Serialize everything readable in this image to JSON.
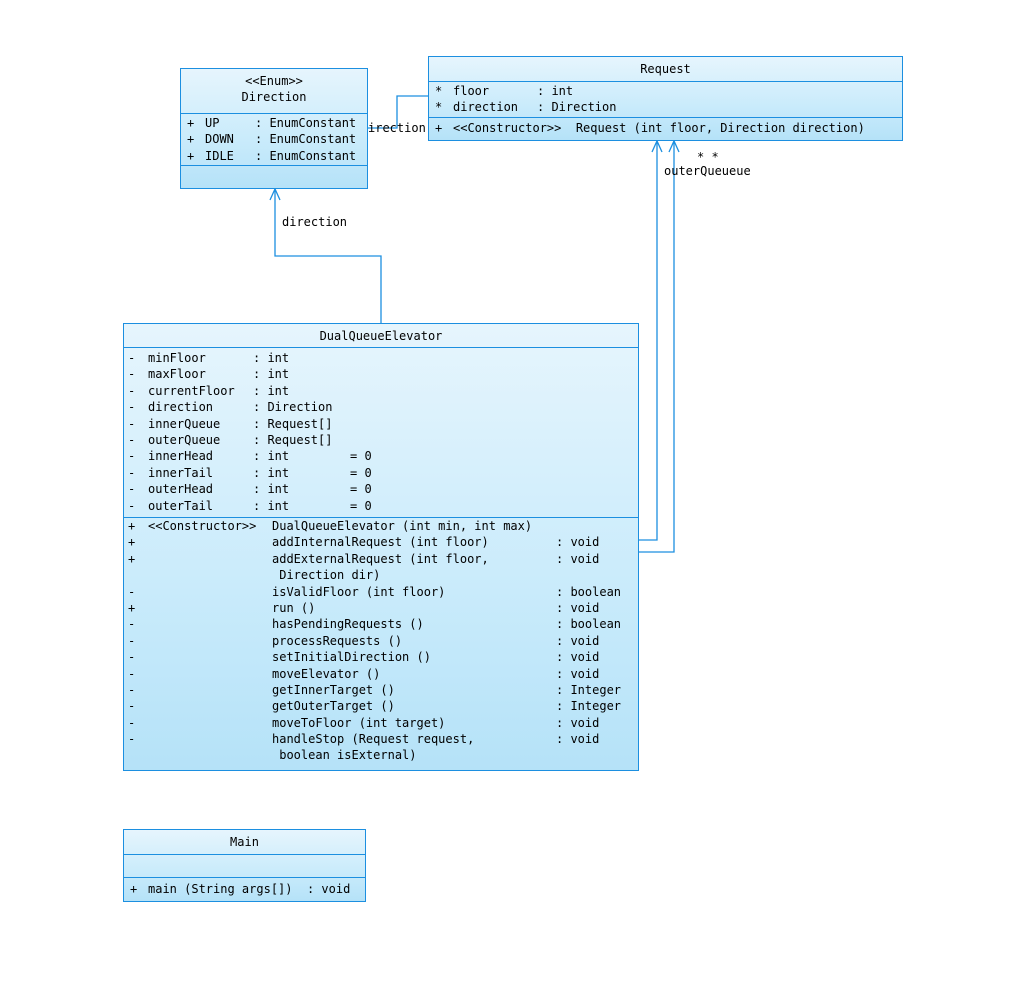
{
  "direction_class": {
    "stereotype": "<<Enum>>",
    "name": "Direction",
    "attributes": [
      {
        "vis": "+",
        "name": "UP",
        "type": ": EnumConstant"
      },
      {
        "vis": "+",
        "name": "DOWN",
        "type": ": EnumConstant"
      },
      {
        "vis": "+",
        "name": "IDLE",
        "type": ": EnumConstant"
      }
    ]
  },
  "request_class": {
    "name": "Request",
    "attributes": [
      {
        "vis": "*",
        "name": "floor",
        "type": ": int"
      },
      {
        "vis": "*",
        "name": "direction",
        "type": ": Direction"
      }
    ],
    "operations": [
      {
        "vis": "+",
        "text": "<<Constructor>>  Request (int floor, Direction direction)"
      }
    ]
  },
  "elevator_class": {
    "name": "DualQueueElevator",
    "attributes": [
      {
        "vis": "-",
        "name": "minFloor",
        "type": ": int",
        "init": ""
      },
      {
        "vis": "-",
        "name": "maxFloor",
        "type": ": int",
        "init": ""
      },
      {
        "vis": "-",
        "name": "currentFloor",
        "type": ": int",
        "init": ""
      },
      {
        "vis": "-",
        "name": "direction",
        "type": ": Direction",
        "init": ""
      },
      {
        "vis": "-",
        "name": "innerQueue",
        "type": ": Request[]",
        "init": ""
      },
      {
        "vis": "-",
        "name": "outerQueue",
        "type": ": Request[]",
        "init": ""
      },
      {
        "vis": "-",
        "name": "innerHead",
        "type": ": int",
        "init": "= 0"
      },
      {
        "vis": "-",
        "name": "innerTail",
        "type": ": int",
        "init": "= 0"
      },
      {
        "vis": "-",
        "name": "outerHead",
        "type": ": int",
        "init": "= 0"
      },
      {
        "vis": "-",
        "name": "outerTail",
        "type": ": int",
        "init": "= 0"
      }
    ],
    "operations": [
      {
        "vis": "+",
        "stereo": "<<Constructor>>",
        "name": "DualQueueElevator (int min, int max)",
        "ret": ""
      },
      {
        "vis": "+",
        "stereo": "",
        "name": "addInternalRequest (int floor)",
        "ret": ": void"
      },
      {
        "vis": "+",
        "stereo": "",
        "name": "addExternalRequest (int floor,",
        "ret": ": void"
      },
      {
        "vis": "",
        "stereo": "",
        "name": " Direction dir)",
        "ret": ""
      },
      {
        "vis": "-",
        "stereo": "",
        "name": "isValidFloor (int floor)",
        "ret": ": boolean"
      },
      {
        "vis": "+",
        "stereo": "",
        "name": "run ()",
        "ret": ": void"
      },
      {
        "vis": "-",
        "stereo": "",
        "name": "hasPendingRequests ()",
        "ret": ": boolean"
      },
      {
        "vis": "-",
        "stereo": "",
        "name": "processRequests ()",
        "ret": ": void"
      },
      {
        "vis": "-",
        "stereo": "",
        "name": "setInitialDirection ()",
        "ret": ": void"
      },
      {
        "vis": "-",
        "stereo": "",
        "name": "moveElevator ()",
        "ret": ": void"
      },
      {
        "vis": "-",
        "stereo": "",
        "name": "getInnerTarget ()",
        "ret": ": Integer"
      },
      {
        "vis": "-",
        "stereo": "",
        "name": "getOuterTarget ()",
        "ret": ": Integer"
      },
      {
        "vis": "-",
        "stereo": "",
        "name": "moveToFloor (int target)",
        "ret": ": void"
      },
      {
        "vis": "-",
        "stereo": "",
        "name": "handleStop (Request request,",
        "ret": ": void"
      },
      {
        "vis": "",
        "stereo": "",
        "name": " boolean isExternal)",
        "ret": ""
      }
    ]
  },
  "main_class": {
    "name": "Main",
    "operations": [
      {
        "vis": "+",
        "text": "main (String args[])  : void"
      }
    ]
  },
  "links": {
    "request_direction_label": "irection",
    "elevator_direction_label": "direction",
    "outer_queue_multiplicity": "* *",
    "outer_queue_label": "outerQueueue"
  },
  "colors": {
    "border": "#1c8fe0",
    "fill_top": "#e6f5fd",
    "fill_bottom": "#b5e2f8"
  }
}
